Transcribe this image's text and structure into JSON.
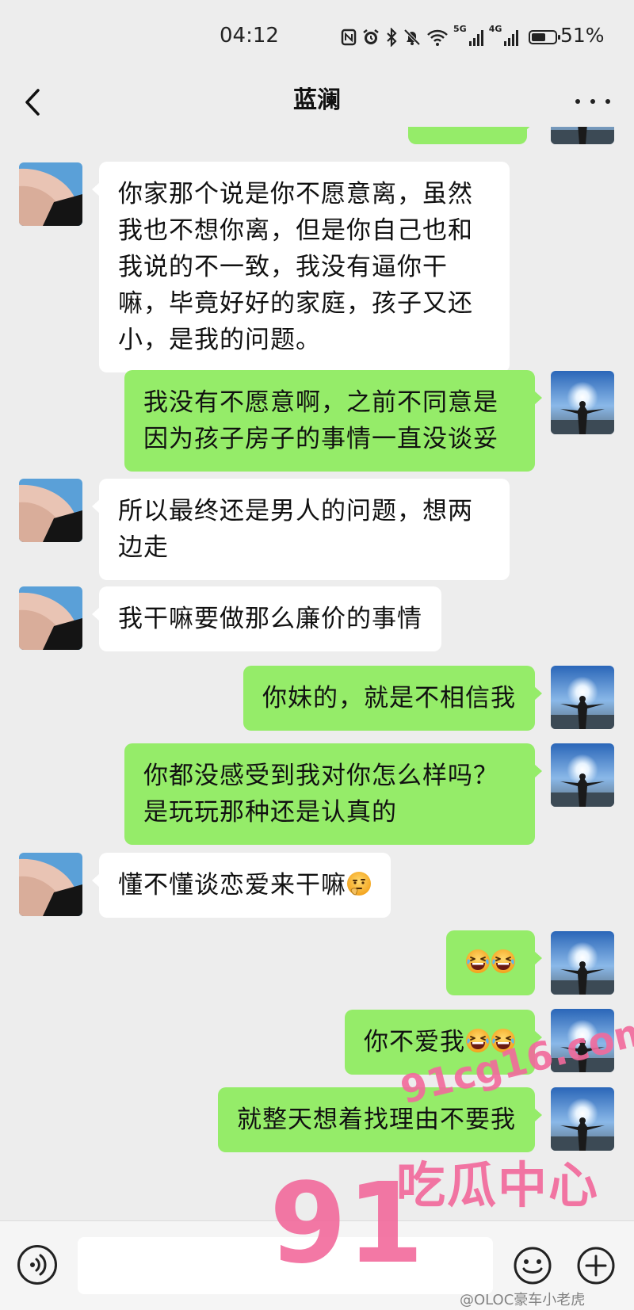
{
  "status_bar": {
    "time": "04:12",
    "network_5g": "5G",
    "network_4g": "4G",
    "battery_percent": "51%"
  },
  "header": {
    "title": "蓝澜"
  },
  "messages": [
    {
      "side": "right",
      "text": ""
    },
    {
      "side": "left",
      "text": "你家那个说是你不愿意离，虽然我也不想你离，但是你自己也和我说的不一致，我没有逼你干嘛，毕竟好好的家庭，孩子又还小，是我的问题。"
    },
    {
      "side": "right",
      "text": "我没有不愿意啊，之前不同意是因为孩子房子的事情一直没谈妥"
    },
    {
      "side": "left",
      "text": "所以最终还是男人的问题，想两边走"
    },
    {
      "side": "left",
      "text": "我干嘛要做那么廉价的事情"
    },
    {
      "side": "right",
      "text": "你妹的，就是不相信我"
    },
    {
      "side": "right",
      "text": "你都没感受到我对你怎么样吗？是玩玩那种还是认真的"
    },
    {
      "side": "left",
      "text": "懂不懂谈恋爱来干嘛"
    },
    {
      "side": "right",
      "text": ""
    },
    {
      "side": "right",
      "text": "你不爱我"
    },
    {
      "side": "right",
      "text": "就整天想着找理由不要我"
    }
  ],
  "input": {
    "value": ""
  },
  "watermark": {
    "number": "91",
    "domain": "91cg16.com",
    "slogan": "吃瓜中心",
    "weibo": "@OLOC豪车小老虎"
  },
  "icons": [
    "back-arrow-icon",
    "more-icon",
    "voice-icon",
    "emoji-icon",
    "plus-icon",
    "grin-squint-emoji",
    "thinking-emoji"
  ],
  "colors": {
    "background": "#ededed",
    "bubble_sent": "#95ec69",
    "bubble_received": "#ffffff",
    "watermark": "#f26a9c"
  }
}
